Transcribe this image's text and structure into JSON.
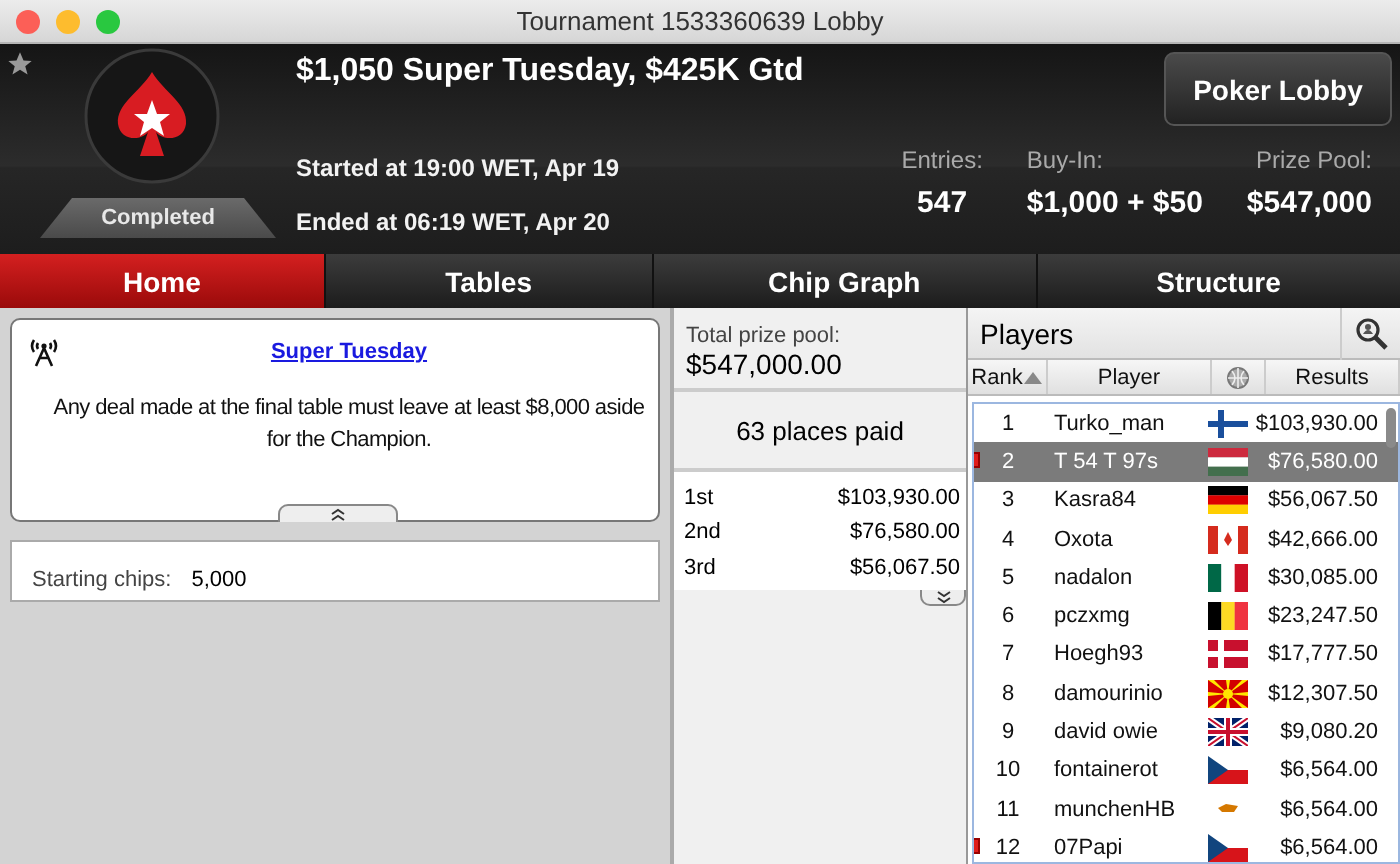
{
  "window": {
    "title": "Tournament 1533360639 Lobby"
  },
  "header": {
    "title": "$1,050 Super Tuesday, $425K Gtd",
    "status": "Completed",
    "started": "Started at 19:00 WET, Apr 19",
    "ended": "Ended at 06:19 WET, Apr 20",
    "favorite": false,
    "lobby_button": "Poker Lobby",
    "stats": [
      {
        "label": "Entries:",
        "value": "547"
      },
      {
        "label": "Buy-In:",
        "value": "$1,000 + $50"
      },
      {
        "label": "Prize Pool:",
        "value": "$547,000"
      }
    ]
  },
  "tabs": [
    {
      "label": "Home",
      "selected": true
    },
    {
      "label": "Tables",
      "selected": false
    },
    {
      "label": "Chip Graph",
      "selected": false
    },
    {
      "label": "Structure",
      "selected": false
    }
  ],
  "notice": {
    "link": "Super Tuesday",
    "text": "Any deal made at the final table must leave at least $8,000 aside for the Champion."
  },
  "starting_chips": {
    "label": "Starting chips:",
    "value": "5,000"
  },
  "prizes": {
    "total_label": "Total prize pool:",
    "total": "$547,000.00",
    "places": "63 places paid",
    "rows": [
      {
        "place": "1st",
        "amount": "$103,930.00"
      },
      {
        "place": "2nd",
        "amount": "$76,580.00"
      },
      {
        "place": "3rd",
        "amount": "$56,067.50"
      }
    ]
  },
  "players": {
    "title": "Players",
    "columns": [
      "Rank",
      "Player",
      "Results"
    ],
    "rows": [
      {
        "rank": "1",
        "name": "Turko_man",
        "result": "$103,930.00",
        "selected": false,
        "marked": false
      },
      {
        "rank": "2",
        "name": "T 54 T 97s",
        "result": "$76,580.00",
        "selected": true,
        "marked": true
      },
      {
        "rank": "3",
        "name": "Kasra84",
        "result": "$56,067.50",
        "selected": false,
        "marked": false
      },
      {
        "rank": "4",
        "name": "Oxota",
        "result": "$42,666.00",
        "selected": false,
        "marked": false
      },
      {
        "rank": "5",
        "name": "nadalon",
        "result": "$30,085.00",
        "selected": false,
        "marked": false
      },
      {
        "rank": "6",
        "name": "pczxmg",
        "result": "$23,247.50",
        "selected": false,
        "marked": false
      },
      {
        "rank": "7",
        "name": "Hoegh93",
        "result": "$17,777.50",
        "selected": false,
        "marked": false
      },
      {
        "rank": "8",
        "name": "damourinio",
        "result": "$12,307.50",
        "selected": false,
        "marked": false
      },
      {
        "rank": "9",
        "name": "david owie",
        "result": "$9,080.20",
        "selected": false,
        "marked": false
      },
      {
        "rank": "10",
        "name": "fontainerot",
        "result": "$6,564.00",
        "selected": false,
        "marked": false
      },
      {
        "rank": "11",
        "name": "munchenHB",
        "result": "$6,564.00",
        "selected": false,
        "marked": false
      },
      {
        "rank": "12",
        "name": "07Papi",
        "result": "$6,564.00",
        "selected": false,
        "marked": true
      }
    ]
  }
}
